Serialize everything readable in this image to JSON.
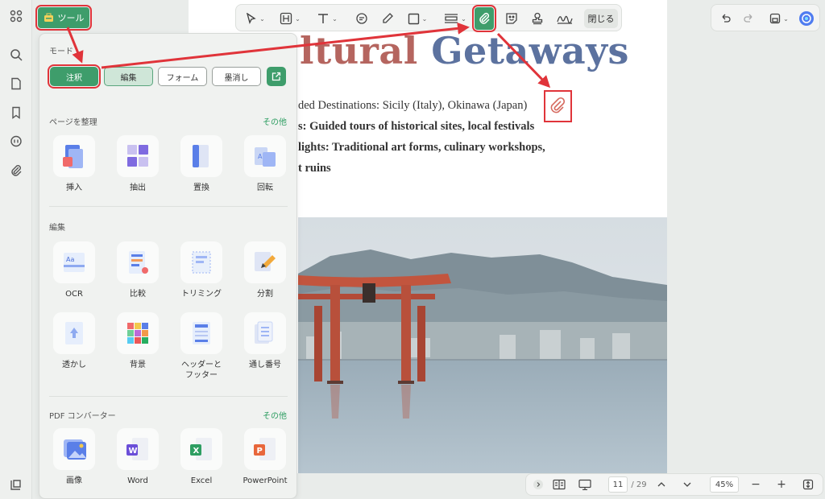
{
  "rail": {
    "icons": [
      "apps-icon",
      "search-icon",
      "page-icon",
      "bookmark-icon",
      "comment-icon",
      "attachment-icon",
      "layers-icon"
    ]
  },
  "tools_button": {
    "label": "ツール"
  },
  "toolbar": {
    "close_label": "閉じる"
  },
  "panel": {
    "mode_title": "モード",
    "modes": [
      "注釈",
      "編集",
      "フォーム",
      "墨消し"
    ],
    "organize": {
      "title": "ページを整理",
      "more": "その他",
      "items": [
        "挿入",
        "抽出",
        "置換",
        "回転"
      ]
    },
    "edit": {
      "title": "編集",
      "row1": [
        "OCR",
        "比較",
        "トリミング",
        "分割"
      ],
      "row2": [
        "透かし",
        "背景",
        "ヘッダーと\nフッター",
        "通し番号"
      ]
    },
    "converter": {
      "title": "PDF コンバーター",
      "more": "その他",
      "items": [
        "画像",
        "Word",
        "Excel",
        "PowerPoint"
      ]
    }
  },
  "document": {
    "title_part1": "ltural ",
    "title_part2": "Getaways",
    "line1": "ded Destinations: Sicily (Italy), Okinawa (Japan)",
    "line2": "s: Guided tours of historical sites, local festivals",
    "line3": "lights: Traditional art forms, culinary workshops,",
    "line4": "t ruins"
  },
  "bottom_bar": {
    "page_current": "11",
    "page_total": "/ 29",
    "zoom": "45%"
  },
  "colors": {
    "accent": "#3e9d6b",
    "annotation_red": "#e0343a",
    "title_red": "#b5655f",
    "title_blue": "#5c729f"
  }
}
